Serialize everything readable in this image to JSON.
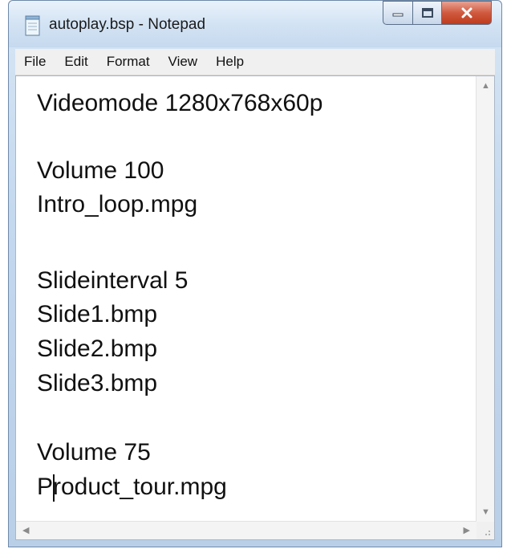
{
  "window": {
    "title": "autoplay.bsp - Notepad"
  },
  "menu": [
    "File",
    "Edit",
    "Format",
    "View",
    "Help"
  ],
  "document": {
    "lines": [
      "Videomode 1280x768x60p",
      "",
      "Volume 100",
      "Intro_loop.mpg",
      "",
      "Slideinterval 5",
      "Slide1.bmp",
      "Slide2.bmp",
      "Slide3.bmp",
      "",
      "Volume 75",
      "Product_tour.mpg"
    ]
  },
  "icons": {
    "app": "notepad-icon",
    "minimize": "minimize-icon",
    "maximize": "maximize-icon",
    "close": "close-icon"
  },
  "colors": {
    "close_button": "#c8452a",
    "titlebar": "#d3e3f4"
  }
}
